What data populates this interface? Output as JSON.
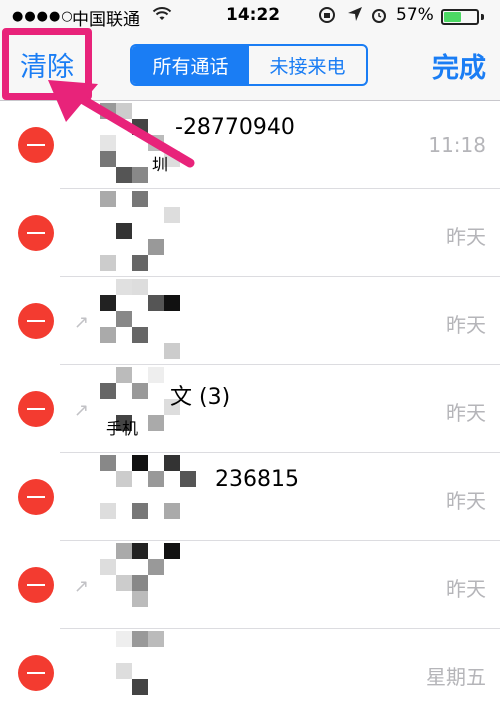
{
  "status_bar": {
    "signal": "●●●●○",
    "carrier": "中国联通",
    "time": "14:22",
    "battery": "57%",
    "battery_level": 0.57
  },
  "nav": {
    "clear_label": "清除",
    "segments": [
      "所有通话",
      "未接来电"
    ],
    "active_segment": 0,
    "done_label": "完成"
  },
  "calls": [
    {
      "name": "-28770940",
      "sub": "圳",
      "time": "11:18",
      "outgoing": false
    },
    {
      "name": "",
      "sub": "",
      "time": "昨天",
      "outgoing": false
    },
    {
      "name": "",
      "sub": "",
      "time": "昨天",
      "outgoing": true
    },
    {
      "name": "文 (3)",
      "sub": "手机",
      "time": "昨天",
      "outgoing": true
    },
    {
      "name": "236815",
      "sub": "",
      "time": "昨天",
      "outgoing": false
    },
    {
      "name": "",
      "sub": "",
      "time": "昨天",
      "outgoing": true
    },
    {
      "name": "",
      "sub": "",
      "time": "星期五",
      "outgoing": false
    }
  ],
  "colors": {
    "accent": "#1a7df4",
    "delete": "#f33b30",
    "highlight": "#e8237a"
  }
}
